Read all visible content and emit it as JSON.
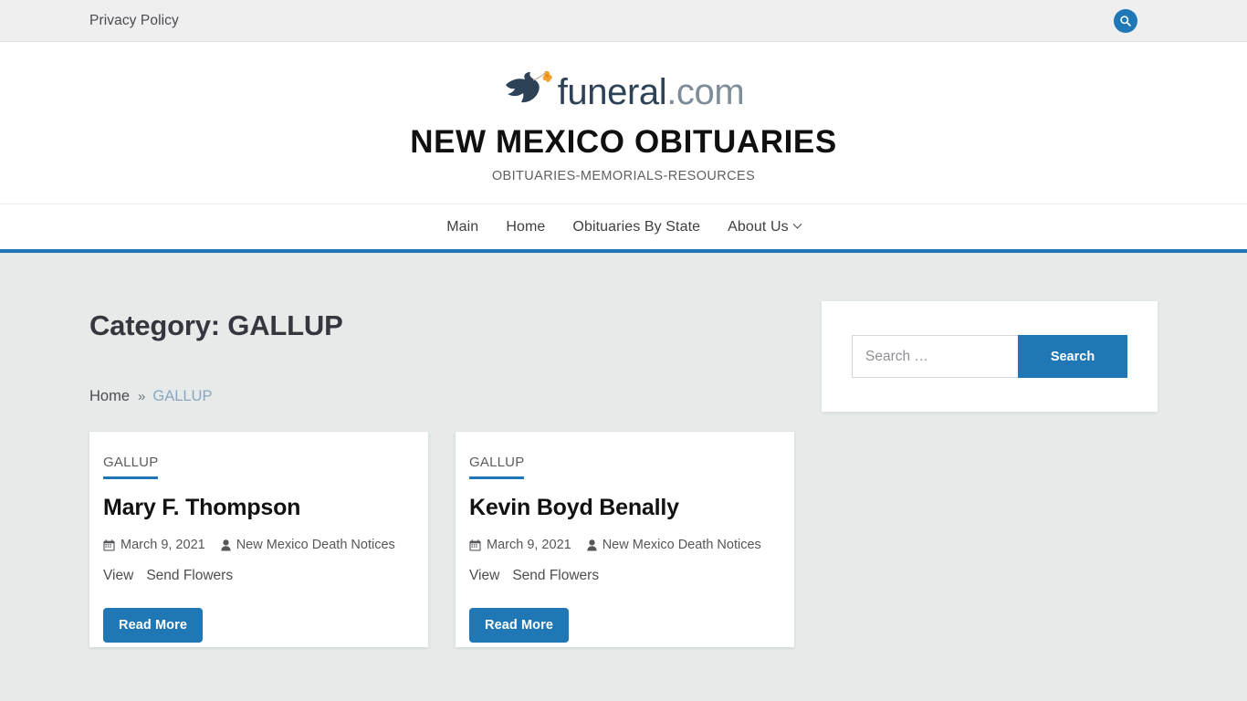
{
  "topbar": {
    "privacy_label": "Privacy Policy",
    "search_icon": "search-icon"
  },
  "masthead": {
    "logo_brand": "funeral",
    "logo_tld": ".com",
    "logo_icon": "dove-with-flower-icon",
    "site_title": "NEW MEXICO OBITUARIES",
    "tagline": "OBITUARIES-MEMORIALS-RESOURCES"
  },
  "nav": {
    "items": [
      {
        "label": "Main",
        "has_dropdown": false
      },
      {
        "label": "Home",
        "has_dropdown": false
      },
      {
        "label": "Obituaries By State",
        "has_dropdown": false
      },
      {
        "label": "About Us",
        "has_dropdown": true
      }
    ]
  },
  "main": {
    "page_title": "Category: GALLUP",
    "breadcrumb": {
      "home": "Home",
      "separator": "»",
      "current": "GALLUP"
    },
    "cards": [
      {
        "category": "GALLUP",
        "title": "Mary F. Thompson",
        "date": "March 9, 2021",
        "author": "New Mexico Death Notices",
        "link_view": "View",
        "link_flowers": "Send Flowers",
        "read_more": "Read More"
      },
      {
        "category": "GALLUP",
        "title": "Kevin Boyd Benally",
        "date": "March 9, 2021",
        "author": "New Mexico Death Notices",
        "link_view": "View",
        "link_flowers": "Send Flowers",
        "read_more": "Read More"
      }
    ]
  },
  "sidebar": {
    "search": {
      "placeholder": "Search …",
      "value": "",
      "button_label": "Search"
    }
  },
  "colors": {
    "accent_blue": "#1f77b6",
    "page_bg": "#e6ebe9",
    "topbar_bg": "#efefef",
    "logo_navy": "#2d4257",
    "crumb_blue": "#8aa5c4"
  }
}
